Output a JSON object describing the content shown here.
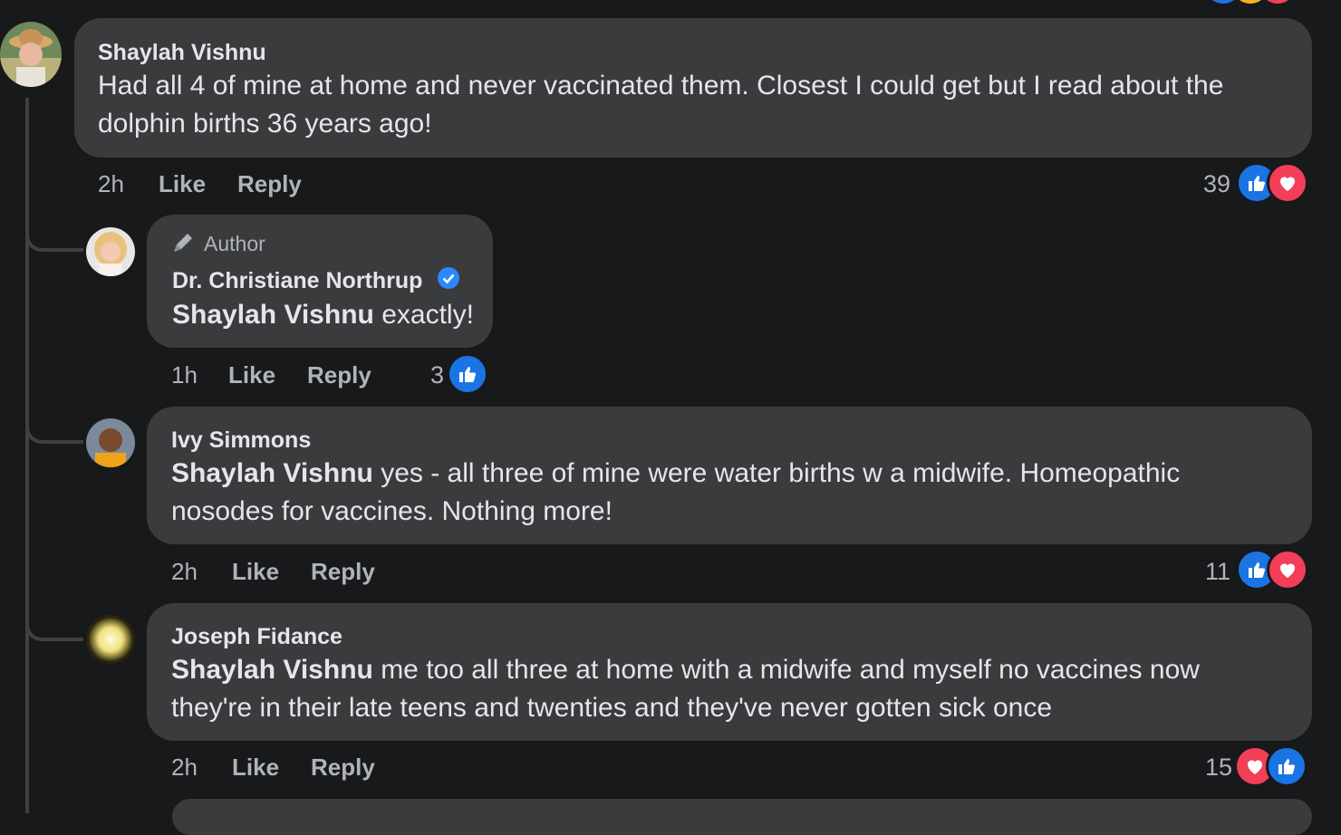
{
  "comments": [
    {
      "author": "Shaylah Vishnu",
      "text": "Had all 4 of mine at home and never vaccinated them. Closest I could get but I read about the dolphin births 36 years ago!",
      "time": "2h",
      "like": "Like",
      "reply": "Reply",
      "reaction_count": "39"
    },
    {
      "badge": "Author",
      "author": "Dr. Christiane Northrup",
      "mention": "Shaylah Vishnu",
      "text": " exactly!",
      "time": "1h",
      "like": "Like",
      "reply": "Reply",
      "reaction_count": "3"
    },
    {
      "author": "Ivy Simmons",
      "mention": "Shaylah Vishnu",
      "text": " yes - all three of mine were water births w a midwife. Homeopathic nosodes for vaccines. Nothing more!",
      "time": "2h",
      "like": "Like",
      "reply": "Reply",
      "reaction_count": "11"
    },
    {
      "author": "Joseph Fidance",
      "mention": "Shaylah Vishnu",
      "text": " me too all three at home with a midwife and myself no vaccines now they're in their late teens and twenties and they've never gotten sick once",
      "time": "2h",
      "like": "Like",
      "reply": "Reply",
      "reaction_count": "15"
    }
  ],
  "colors": {
    "background": "#18191a",
    "bubble": "#3a3b3c",
    "like": "#1b74e4",
    "love": "#f33e58",
    "verified": "#2d88ff"
  },
  "icons": [
    "thumbs-up-icon",
    "heart-icon",
    "verified-badge-icon",
    "author-pen-icon"
  ]
}
